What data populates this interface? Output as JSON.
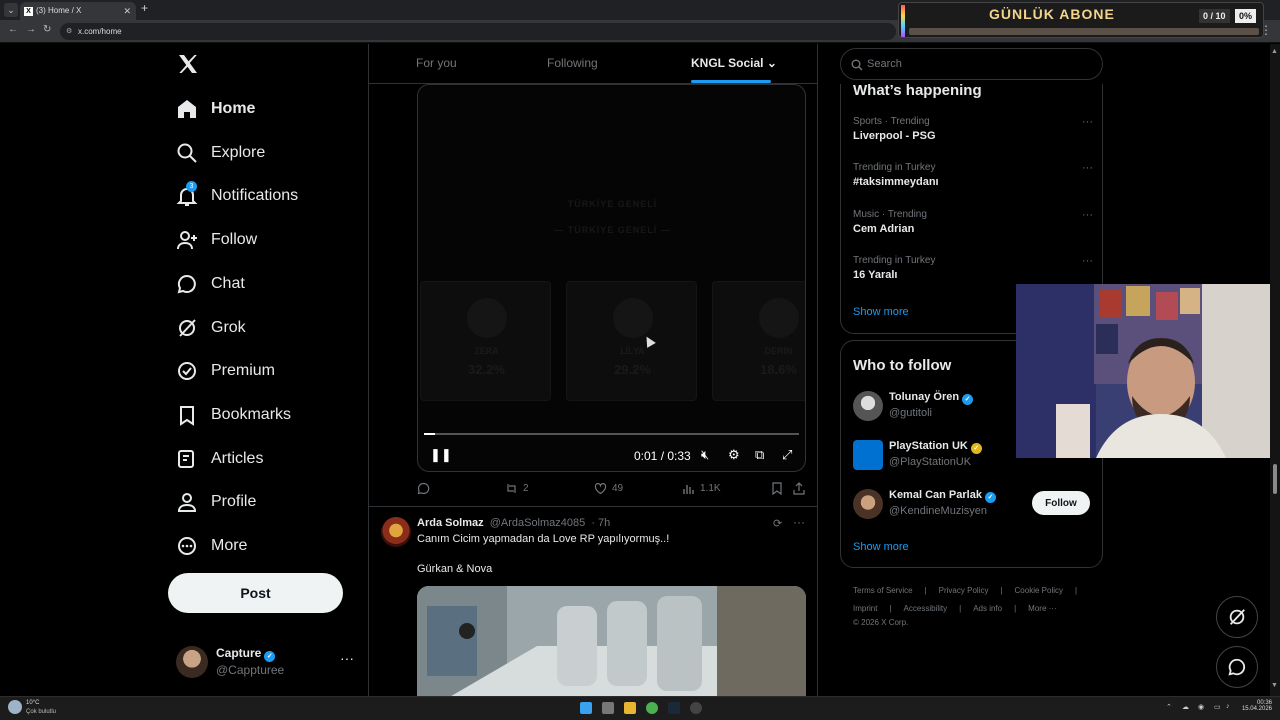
{
  "browser": {
    "tab_title": "(3) Home / X",
    "url": "x.com/home"
  },
  "overlay": {
    "title": "GÜNLÜK ABONE",
    "count": "0 / 10",
    "percent": "0%",
    "progress": 0
  },
  "sidebar": {
    "items": [
      {
        "label": "Home",
        "icon": "home-icon"
      },
      {
        "label": "Explore",
        "icon": "search-icon"
      },
      {
        "label": "Notifications",
        "icon": "bell-icon",
        "badge": "3"
      },
      {
        "label": "Follow",
        "icon": "person-add-icon"
      },
      {
        "label": "Chat",
        "icon": "chat-bubble-icon"
      },
      {
        "label": "Grok",
        "icon": "grok-icon"
      },
      {
        "label": "Premium",
        "icon": "premium-badge-icon"
      },
      {
        "label": "Bookmarks",
        "icon": "bookmark-icon"
      },
      {
        "label": "Articles",
        "icon": "article-icon"
      },
      {
        "label": "Profile",
        "icon": "person-icon"
      },
      {
        "label": "More",
        "icon": "more-circle-icon"
      }
    ],
    "post_label": "Post",
    "account": {
      "name": "Capture",
      "handle": "@Cappturee"
    }
  },
  "feed": {
    "tabs": [
      "For you",
      "Following",
      "KNGL Social"
    ],
    "active_tab": 2,
    "video": {
      "faint_title": "TÜRKİYE GENELİ",
      "faint_subtitle": "— TÜRKİYE GENELİ —",
      "cards": [
        {
          "name": "ZERA",
          "pct": "32.2%"
        },
        {
          "name": "LİLYA",
          "pct": "29.2%"
        },
        {
          "name": "DERİN",
          "pct": "18.6%"
        }
      ],
      "time": "0:01 / 0:33",
      "progress": 0.03
    },
    "actions": {
      "replies": "",
      "reposts": "2",
      "likes": "49",
      "views": "1.1K"
    },
    "tweet": {
      "name": "Arda Solmaz",
      "handle": "@ArdaSolmaz4085",
      "time": "· 7h",
      "line1": "Canım Cicim yapmadan da Love RP yapılıyormuş..!",
      "line2": "Gürkan & Nova"
    }
  },
  "right": {
    "search_placeholder": "Search",
    "happening_title": "What’s happening",
    "trends": [
      {
        "meta": "Sports · Trending",
        "name": "Liverpool - PSG"
      },
      {
        "meta": "Trending in Turkey",
        "name": "#taksimmeydanı"
      },
      {
        "meta": "Music · Trending",
        "name": "Cem Adrian"
      },
      {
        "meta": "Trending in Turkey",
        "name": "16 Yaralı"
      }
    ],
    "show_more": "Show more",
    "who_title": "Who to follow",
    "who": [
      {
        "name": "Tolunay Ören",
        "handle": "@gutitoli"
      },
      {
        "name": "PlayStation UK",
        "handle": "@PlayStationUK"
      },
      {
        "name": "Kemal Can Parlak",
        "handle": "@KendineMuzisyen",
        "button": "Follow"
      }
    ],
    "footer_line1": [
      "Terms of Service",
      "|",
      "Privacy Policy",
      "|",
      "Cookie Policy",
      "|"
    ],
    "footer_line2": [
      "Imprint",
      "|",
      "Accessibility",
      "|",
      "Ads info",
      "|",
      "More ···"
    ],
    "copyright": "© 2026 X Corp."
  },
  "taskbar": {
    "temp": "10°C",
    "condition": "Çok bulutlu",
    "time": "00:36",
    "date": "15.04.2026"
  },
  "colors": {
    "accent": "#1d9bf0",
    "background": "#000000",
    "border": "#2f3336",
    "muted": "#71767b"
  }
}
